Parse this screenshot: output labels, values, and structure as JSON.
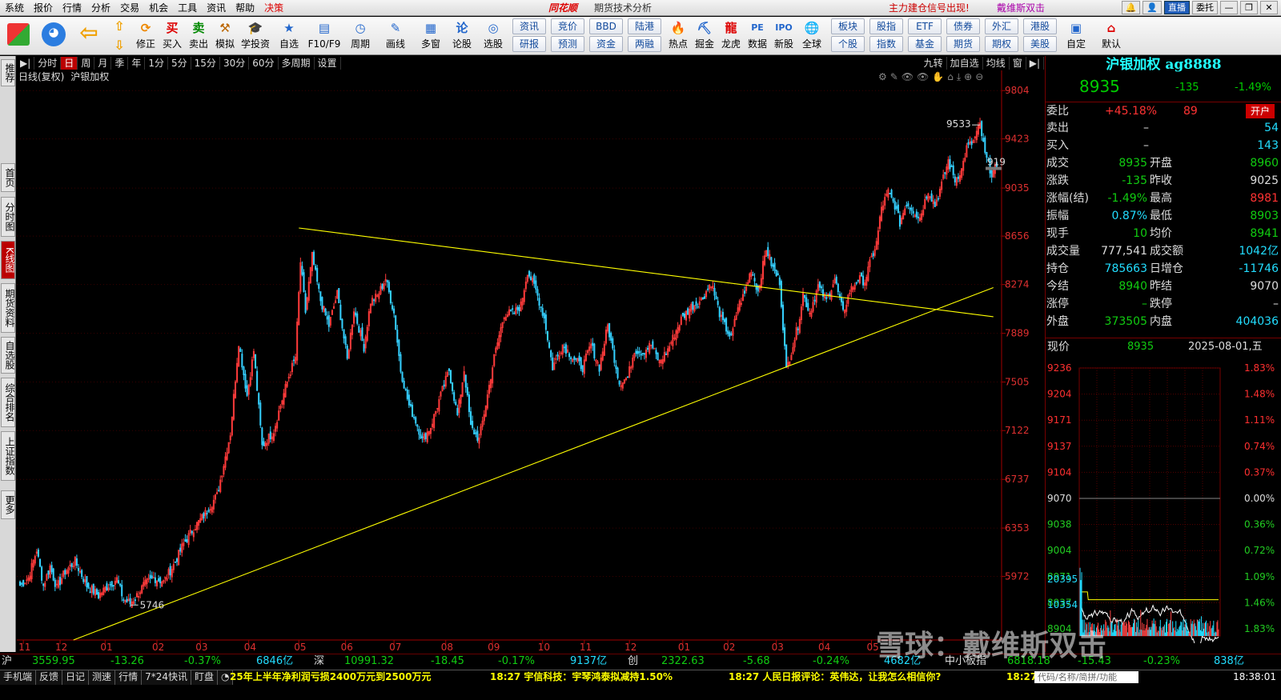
{
  "menu": {
    "items": [
      "系统",
      "报价",
      "行情",
      "分析",
      "交易",
      "机会",
      "工具",
      "资讯",
      "帮助"
    ],
    "decision": "决策",
    "logo": "同花顺",
    "app_title": "期货技术分析",
    "signal": "主力建仓信号出现!",
    "signal_author": "戴维斯双击",
    "live_btn": "直播",
    "order_btn": "委托"
  },
  "toolbar": {
    "left_buttons": [
      "修正",
      "买入",
      "卖出",
      "模拟",
      "学投资",
      "自选",
      "F10/F9",
      "周期",
      "画线",
      "多窗",
      "论股",
      "选股"
    ],
    "grid_buttons": [
      [
        "资讯",
        "竞价",
        "BBD",
        "陆港"
      ],
      [
        "研报",
        "预测",
        "资金",
        "两融"
      ]
    ],
    "right_buttons": [
      "热点",
      "掘金",
      "龙虎",
      "数据",
      "新股",
      "全球"
    ],
    "grid2_buttons": [
      [
        "板块",
        "股指",
        "ETF",
        "债券",
        "外汇",
        "港股"
      ],
      [
        "个股",
        "指数",
        "基金",
        "期货",
        "期权",
        "美股"
      ]
    ],
    "far_right_buttons": [
      "自定",
      "默认"
    ]
  },
  "left_tabs": [
    "推荐",
    "首页",
    "分时图",
    "K线图",
    "期货资料",
    "自选股",
    "综合排名",
    "上证指数",
    "更多"
  ],
  "period_bar": {
    "items": [
      "分时",
      "日",
      "周",
      "月",
      "季",
      "年",
      "1分",
      "5分",
      "15分",
      "30分",
      "60分",
      "多周期",
      "设置"
    ],
    "active": "日",
    "right_items": [
      "九转",
      "加自选",
      "均线",
      "窗"
    ]
  },
  "chart_header": {
    "label": "日线(复权)",
    "name": "沪银加权"
  },
  "chart_data": {
    "type": "candlestick",
    "title": "日线(复权) 沪银加权",
    "y_ticks": [
      9804,
      9423,
      9035,
      8656,
      8274,
      7889,
      7505,
      7122,
      6737,
      6353,
      5972
    ],
    "ylim": [
      5470,
      9900
    ],
    "x_ticks": [
      "11",
      "12",
      "01",
      "02",
      "03",
      "04",
      "05",
      "06",
      "07",
      "08",
      "09",
      "10",
      "11",
      "12",
      "01",
      "02",
      "03",
      "04",
      "05"
    ],
    "x_tick_index": [
      2,
      24,
      51,
      82,
      108,
      137,
      167,
      195,
      224,
      255,
      283,
      313,
      338,
      365,
      397,
      424,
      453,
      481,
      510
    ],
    "max_label": "9533",
    "min_label": "5746",
    "last_price_label": "919",
    "trendlines": [
      {
        "from": [
          167,
          8720
        ],
        "to": [
          583,
          8020
        ]
      },
      {
        "from": [
          32,
          5470
        ],
        "to": [
          583,
          8250
        ]
      }
    ],
    "anchors": [
      [
        0,
        5900
      ],
      [
        5,
        5960
      ],
      [
        10,
        6180
      ],
      [
        14,
        5900
      ],
      [
        18,
        6050
      ],
      [
        22,
        5880
      ],
      [
        27,
        6010
      ],
      [
        33,
        6090
      ],
      [
        40,
        5900
      ],
      [
        47,
        5820
      ],
      [
        52,
        5890
      ],
      [
        58,
        5950
      ],
      [
        62,
        5790
      ],
      [
        66,
        5760
      ],
      [
        70,
        5820
      ],
      [
        74,
        5900
      ],
      [
        80,
        5960
      ],
      [
        86,
        5930
      ],
      [
        92,
        6060
      ],
      [
        98,
        6230
      ],
      [
        104,
        6350
      ],
      [
        110,
        6450
      ],
      [
        118,
        6610
      ],
      [
        126,
        7100
      ],
      [
        131,
        7820
      ],
      [
        136,
        7400
      ],
      [
        140,
        7750
      ],
      [
        145,
        7000
      ],
      [
        152,
        7120
      ],
      [
        156,
        7320
      ],
      [
        161,
        7550
      ],
      [
        165,
        7700
      ],
      [
        168,
        8450
      ],
      [
        171,
        8060
      ],
      [
        175,
        8500
      ],
      [
        180,
        8150
      ],
      [
        185,
        7950
      ],
      [
        190,
        8200
      ],
      [
        196,
        7680
      ],
      [
        200,
        8080
      ],
      [
        206,
        7780
      ],
      [
        210,
        8140
      ],
      [
        214,
        8180
      ],
      [
        219,
        8320
      ],
      [
        224,
        8050
      ],
      [
        228,
        7600
      ],
      [
        233,
        7320
      ],
      [
        237,
        7200
      ],
      [
        241,
        7050
      ],
      [
        246,
        7150
      ],
      [
        252,
        7400
      ],
      [
        257,
        7600
      ],
      [
        262,
        7240
      ],
      [
        266,
        7600
      ],
      [
        270,
        7150
      ],
      [
        275,
        7050
      ],
      [
        280,
        7400
      ],
      [
        284,
        7700
      ],
      [
        290,
        8040
      ],
      [
        296,
        8050
      ],
      [
        300,
        8110
      ],
      [
        304,
        8380
      ],
      [
        309,
        8230
      ],
      [
        314,
        8010
      ],
      [
        319,
        7620
      ],
      [
        325,
        7800
      ],
      [
        331,
        7700
      ],
      [
        337,
        7620
      ],
      [
        342,
        7800
      ],
      [
        347,
        7620
      ],
      [
        352,
        7950
      ],
      [
        359,
        7500
      ],
      [
        364,
        7540
      ],
      [
        368,
        7760
      ],
      [
        373,
        7740
      ],
      [
        378,
        7800
      ],
      [
        383,
        7660
      ],
      [
        388,
        7760
      ],
      [
        396,
        8000
      ],
      [
        402,
        8100
      ],
      [
        408,
        8150
      ],
      [
        414,
        8290
      ],
      [
        420,
        8000
      ],
      [
        426,
        7850
      ],
      [
        430,
        8100
      ],
      [
        434,
        8200
      ],
      [
        438,
        8400
      ],
      [
        442,
        8220
      ],
      [
        447,
        8560
      ],
      [
        451,
        8400
      ],
      [
        455,
        8300
      ],
      [
        459,
        7600
      ],
      [
        463,
        7800
      ],
      [
        466,
        7950
      ],
      [
        469,
        8200
      ],
      [
        473,
        8050
      ],
      [
        478,
        8260
      ],
      [
        483,
        8150
      ],
      [
        488,
        8320
      ],
      [
        493,
        8050
      ],
      [
        497,
        8220
      ],
      [
        502,
        8320
      ],
      [
        506,
        8300
      ],
      [
        510,
        8480
      ],
      [
        513,
        8600
      ],
      [
        516,
        8880
      ],
      [
        520,
        9000
      ],
      [
        524,
        8900
      ],
      [
        527,
        8760
      ],
      [
        531,
        8920
      ],
      [
        535,
        8860
      ],
      [
        539,
        8800
      ],
      [
        544,
        9020
      ],
      [
        548,
        8900
      ],
      [
        552,
        9060
      ],
      [
        556,
        9250
      ],
      [
        560,
        9100
      ],
      [
        564,
        9180
      ],
      [
        567,
        9350
      ],
      [
        571,
        9400
      ],
      [
        575,
        9533
      ],
      [
        578,
        9300
      ],
      [
        582,
        9150
      ],
      [
        585,
        9200
      ]
    ]
  },
  "right_panel": {
    "title": "沪银加权 ag8888",
    "price": "8935",
    "change": "-135",
    "change_pct": "-1.49%",
    "weibi": {
      "label": "委比",
      "pct": "+45.18%",
      "val": "89",
      "btn": "开户"
    },
    "rows": [
      {
        "l": "卖出",
        "v": "–",
        "v2": "54"
      },
      {
        "l": "买入",
        "v": "–",
        "v2": "143"
      }
    ],
    "pairs": [
      {
        "l1": "成交",
        "v1": "8935",
        "l2": "开盘",
        "v2": "8960"
      },
      {
        "l1": "涨跌",
        "v1": "-135",
        "l2": "昨收",
        "v2": "9025"
      },
      {
        "l1": "涨幅(结)",
        "v1": "-1.49%",
        "l2": "最高",
        "v2": "8981"
      },
      {
        "l1": "振幅",
        "v1": "0.87%",
        "l2": "最低",
        "v2": "8903"
      },
      {
        "l1": "现手",
        "v1": "10",
        "l2": "均价",
        "v2": "8941"
      },
      {
        "l1": "成交量",
        "v1": "777,541",
        "l2": "成交额",
        "v2": "1042亿"
      },
      {
        "l1": "持仓",
        "v1": "785663",
        "l2": "日增仓",
        "v2": "-11746"
      },
      {
        "l1": "今结",
        "v1": "8940",
        "l2": "昨结",
        "v2": "9070"
      },
      {
        "l1": "涨停",
        "v1": "–",
        "l2": "跌停",
        "v2": "–"
      },
      {
        "l1": "外盘",
        "v1": "373505",
        "l2": "内盘",
        "v2": "404036"
      }
    ],
    "mini": {
      "label": "现价",
      "price": "8935",
      "date": "2025-08-01,五",
      "left_ticks": [
        "9236",
        "9204",
        "9171",
        "9137",
        "9104",
        "9070",
        "9038",
        "9004",
        "8971",
        "8937",
        "8904"
      ],
      "right_ticks": [
        "1.83%",
        "1.48%",
        "1.11%",
        "0.74%",
        "0.37%",
        "0.00%",
        "0.36%",
        "0.72%",
        "1.09%",
        "1.46%",
        "1.83%"
      ],
      "vol_ticks": [
        "20395",
        "10354"
      ]
    }
  },
  "bottom_index": [
    {
      "name": "沪",
      "val": "3559.95",
      "chg": "-13.26",
      "pct": "-0.37%",
      "amt": "6846亿"
    },
    {
      "name": "深",
      "val": "10991.32",
      "chg": "-18.45",
      "pct": "-0.17%",
      "amt": "9137亿"
    },
    {
      "name": "创",
      "val": "2322.63",
      "chg": "-5.68",
      "pct": "-0.24%",
      "amt": "4682亿"
    },
    {
      "name": "中小板指",
      "val": "6818.18",
      "chg": "-15.43",
      "pct": "-0.23%",
      "amt": "838亿"
    }
  ],
  "status": {
    "tabs": [
      "手机端",
      "反馈",
      "日记",
      "测速",
      "行情",
      "7*24快讯",
      "盯盘"
    ],
    "news": [
      "25年上半年净利润亏损2400万元到2500万元",
      "18:27 宇信科技：宇琴鸿泰拟减持1.50%",
      "18:27 人民日报评论：英伟达，让我怎么相信你?",
      "18:27"
    ],
    "search_placeholder": "代码/名称/简拼/功能",
    "clock": "18:38:01"
  },
  "watermark": "雪球：戴维斯双击",
  "colors": {
    "up": "#ff3b3b",
    "down": "#35d0ff",
    "trend": "#ffff00",
    "axis": "#a00000",
    "grid": "#3a0000"
  }
}
